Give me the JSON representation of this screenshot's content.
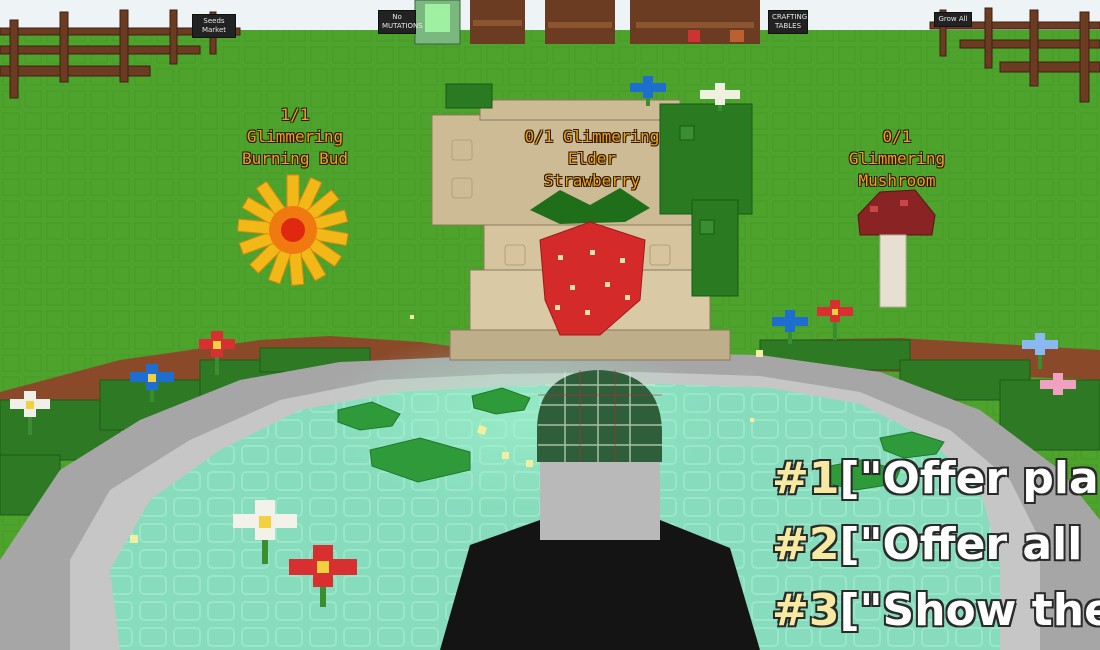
{
  "signs": [
    {
      "text": "Seeds Market"
    },
    {
      "text": "No MUTATIONS"
    },
    {
      "text": "CRAFTING TABLES"
    },
    {
      "text": "Grow All"
    }
  ],
  "plants": [
    {
      "count": "1/1",
      "name_line1": "Glimmering",
      "name_line2": "Burning Bud"
    },
    {
      "count": "0/1",
      "name_line1": "Glimmering",
      "name_line2": "Elder",
      "name_line3": "Strawberry"
    },
    {
      "count": "0/1",
      "name_line1": "Glimmering",
      "name_line2": "Mushroom"
    }
  ],
  "options": [
    {
      "number": "#1",
      "text": "[\"Offer pla"
    },
    {
      "number": "#2",
      "text": "[\"Offer all"
    },
    {
      "number": "#3",
      "text": "[\"Show the"
    }
  ],
  "colors": {
    "sky": "#eef3f6",
    "grass": "#4a9e2a",
    "water": "#7ed9b8",
    "label_orange": "#f0a020",
    "option_number": "#f6e9a2"
  }
}
